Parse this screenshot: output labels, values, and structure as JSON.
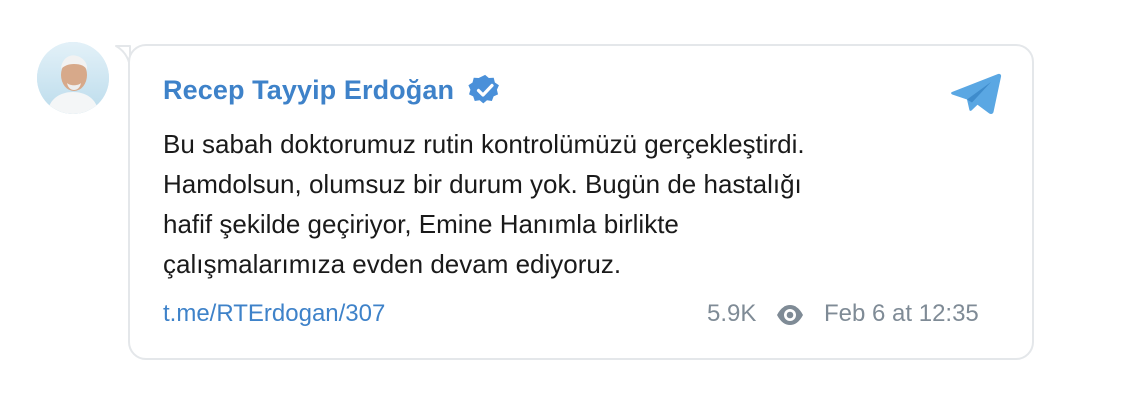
{
  "channel": {
    "name": "Recep Tayyip Erdoğan",
    "verified": true,
    "avatar_icon": "profile-photo",
    "platform_icon": "telegram-icon"
  },
  "message": {
    "lines": [
      "Bu sabah doktorumuz rutin kontrolümüzü gerçekleştirdi.",
      "Hamdolsun, olumsuz bir durum yok. Bugün de hastalığı",
      "hafif şekilde geçiriyor, Emine Hanımla birlikte",
      "çalışmalarımıza evden devam ediyoruz."
    ]
  },
  "footer": {
    "link": "t.me/RTErdogan/307",
    "views": "5.9K",
    "views_icon": "eye-icon",
    "date": "Feb 6 at 12:35"
  },
  "colors": {
    "accent": "#3e82c9",
    "text": "#1a1a1a",
    "muted": "#7f8b96",
    "border": "#e4e7ea"
  }
}
